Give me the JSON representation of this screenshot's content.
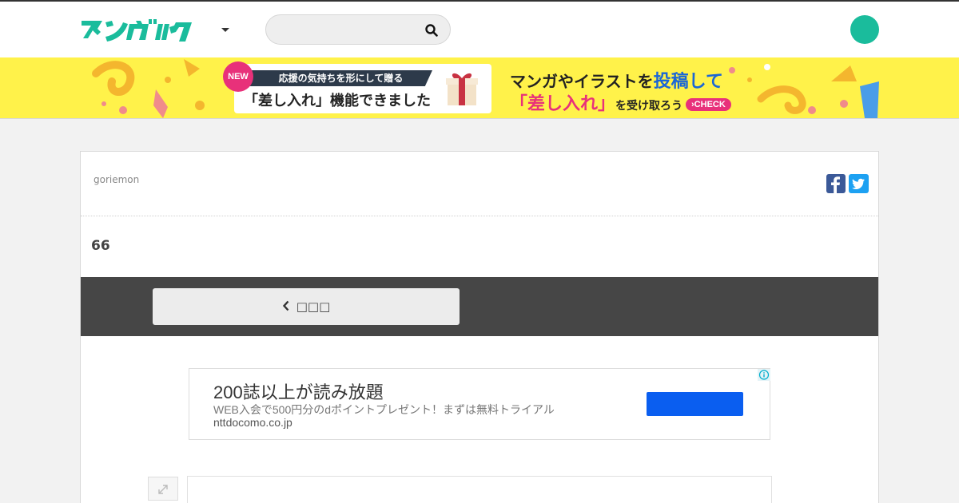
{
  "header": {
    "logo_text": "マンガハック",
    "search_placeholder": "",
    "colors": {
      "brand": "#1abc9c",
      "avatar": "#1abc9c"
    }
  },
  "banner": {
    "badge": "NEW",
    "subtitle": "応援の気持ちを形にして贈る",
    "headline": "「差し入れ」機能できました",
    "right_line1_a": "マンガやイラストを",
    "right_line1_b": "投稿して",
    "right_line2_a": "「差し入れ」",
    "right_line2_b": "を受け取ろう",
    "check": "›CHECK",
    "colors": {
      "background": "#fff24a",
      "accent": "#e8317a"
    }
  },
  "post": {
    "author": "goriemon",
    "title": "66",
    "prev_label": "□□□"
  },
  "ad": {
    "title": "200誌以上が読み放題",
    "description": "WEB入会で500円分のdポイントプレゼント！まずは無料トライアル",
    "url": "nttdocomo.co.jp",
    "button_color": "#0a5ef0"
  },
  "icons": [
    "caret-down-icon",
    "search-icon",
    "facebook-icon",
    "twitter-icon",
    "chevron-left-icon",
    "info-icon",
    "expand-icon",
    "gift-icon"
  ]
}
